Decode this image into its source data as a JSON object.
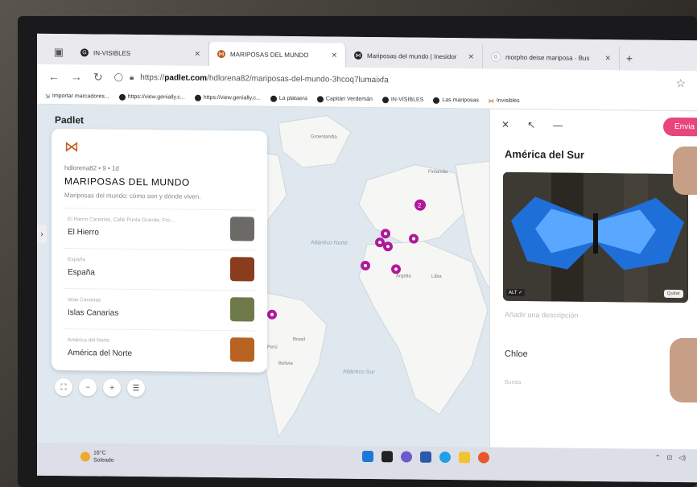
{
  "tabs": [
    {
      "label": "IN-VISIBLES",
      "active": false
    },
    {
      "label": "MARIPOSAS DEL MUNDO",
      "active": true
    },
    {
      "label": "Mariposas del mundo | Inesidor",
      "active": false
    },
    {
      "label": "morpho deise mariposa · Bus",
      "active": false
    }
  ],
  "url": {
    "prefix": "https://",
    "domain": "padlet.com",
    "path": "/hdlorena82/mariposas-del-mundo-3hcoq7lumaixfa"
  },
  "bookmarks": [
    "Importar marcadores...",
    "https://view.genially.c...",
    "https://view.genially.c...",
    "La plataera",
    "Capitán Verdemán",
    "IN-VISIBLES",
    "Las mariposas",
    "Invisibles"
  ],
  "padlet": {
    "logo": "Padlet",
    "meta": "hdlorena82 • 9 • 1d",
    "title": "MARIPOSAS DEL MUNDO",
    "description": "Mariposas del mundo: cómo son y dónde viven.",
    "posts": [
      {
        "caption": "El Hierro Canarias, Calle Punta Grande, Fro...",
        "title": "El Hierro",
        "thumb_color": "#6b6a66"
      },
      {
        "caption": "España",
        "title": "España",
        "thumb_color": "#8a3d1e"
      },
      {
        "caption": "Islas Canarias",
        "title": "Islas Canarias",
        "thumb_color": "#6f7a4a"
      },
      {
        "caption": "América del Norte",
        "title": "América del Norte",
        "thumb_color": "#b86322"
      }
    ]
  },
  "map": {
    "labels": [
      "Groenlandia",
      "Finlandia",
      "Atlántico Norte",
      "Atlántico Sur",
      "Argelia",
      "Libia",
      "Brasil",
      "Perú",
      "Bolivia"
    ],
    "cluster_count": "2"
  },
  "detail": {
    "title": "América del Sur",
    "send_label": "Envia",
    "alt_label": "ALT ✓",
    "quitar_label": "Quitar",
    "desc_placeholder": "Añadir una descripción",
    "author": "Chloe",
    "sub": "Bunda"
  },
  "taskbar": {
    "temp": "16°C",
    "weather": "Soleado"
  },
  "colors": {
    "accent": "#e8457a",
    "pin": "#b0189a",
    "water": "#dfe8ef"
  }
}
